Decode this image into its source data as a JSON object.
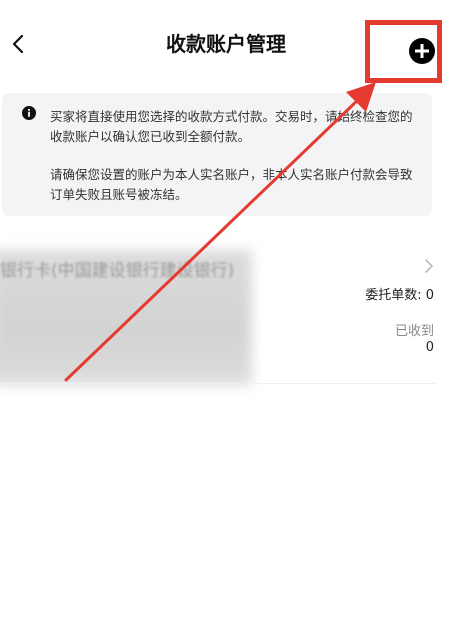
{
  "header": {
    "title": "收款账户管理",
    "back_icon": "chevron-left-icon",
    "add_icon": "plus-circle-icon"
  },
  "notice": {
    "icon": "info-icon",
    "paragraph1": "买家将直接使用您选择的收款方式付款。交易时，请始终检查您的收款账户以确认您已收到全额付款。",
    "paragraph2": "请确保您设置的账户为本人实名账户，非本人实名账户付款会导致订单失败且账号被冻结。"
  },
  "account": {
    "name": "银行卡(中国建设银行建设银行)",
    "entrust_label": "委托单数",
    "entrust_value": "0",
    "received_label": "已收到",
    "received_value": "0"
  },
  "annotation": {
    "highlight_color": "#e53a2f"
  }
}
